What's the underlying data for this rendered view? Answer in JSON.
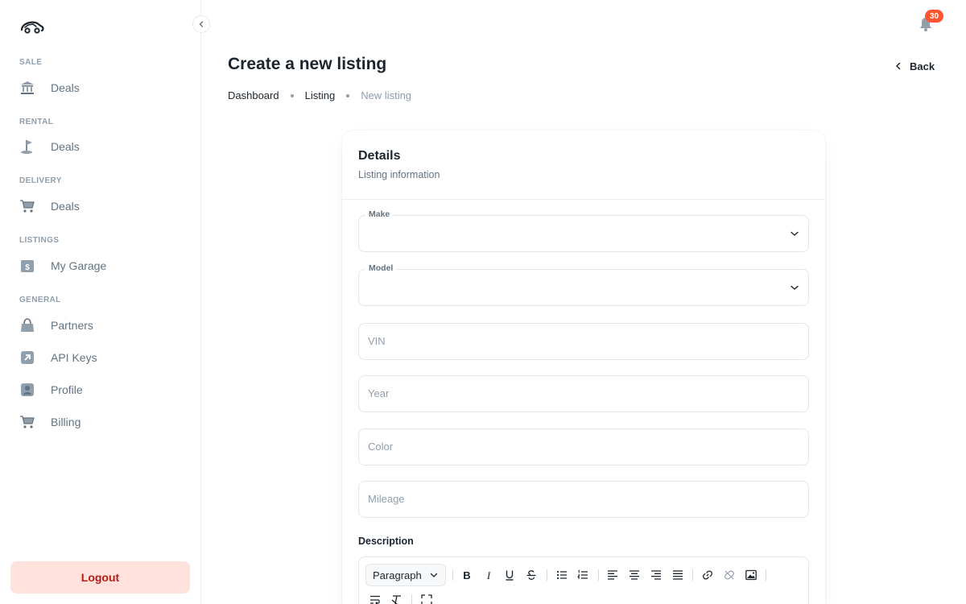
{
  "sidebar": {
    "sections": [
      {
        "label": "SALE",
        "items": [
          {
            "label": "Deals",
            "icon": "bank-icon"
          }
        ]
      },
      {
        "label": "RENTAL",
        "items": [
          {
            "label": "Deals",
            "icon": "golf-flag-icon"
          }
        ]
      },
      {
        "label": "DELIVERY",
        "items": [
          {
            "label": "Deals",
            "icon": "cart-icon"
          }
        ]
      },
      {
        "label": "LISTINGS",
        "items": [
          {
            "label": "My Garage",
            "icon": "invoice-icon"
          }
        ]
      },
      {
        "label": "GENERAL",
        "items": [
          {
            "label": "Partners",
            "icon": "bag-icon"
          },
          {
            "label": "API Keys",
            "icon": "external-arrow-icon"
          },
          {
            "label": "Profile",
            "icon": "user-icon"
          },
          {
            "label": "Billing",
            "icon": "cart-icon"
          }
        ]
      }
    ],
    "logout_label": "Logout"
  },
  "header": {
    "title": "Create a new listing",
    "back_label": "Back",
    "notification_count": "30",
    "breadcrumb": [
      "Dashboard",
      "Listing",
      "New listing"
    ]
  },
  "form": {
    "card_title": "Details",
    "card_subtitle": "Listing information",
    "make": {
      "label": "Make",
      "value": ""
    },
    "model": {
      "label": "Model",
      "value": ""
    },
    "vin": {
      "placeholder": "VIN"
    },
    "year": {
      "placeholder": "Year"
    },
    "color": {
      "placeholder": "Color"
    },
    "mileage": {
      "placeholder": "Mileage"
    },
    "description_label": "Description",
    "editor": {
      "block_format": "Paragraph",
      "toolbar_icons": [
        "bold-icon",
        "italic-icon",
        "underline-icon",
        "strikethrough-icon",
        "bullet-list-icon",
        "ordered-list-icon",
        "align-left-icon",
        "align-center-icon",
        "align-right-icon",
        "align-justify-icon",
        "link-icon",
        "unlink-icon",
        "image-icon",
        "text-wrap-icon",
        "clear-format-icon",
        "fullscreen-icon"
      ]
    }
  },
  "colors": {
    "logout_bg": "#FFE2DB",
    "logout_text": "#B71D18",
    "badge": "#FF5630",
    "muted_text": "#637381",
    "placeholder_text": "#919EAB"
  }
}
